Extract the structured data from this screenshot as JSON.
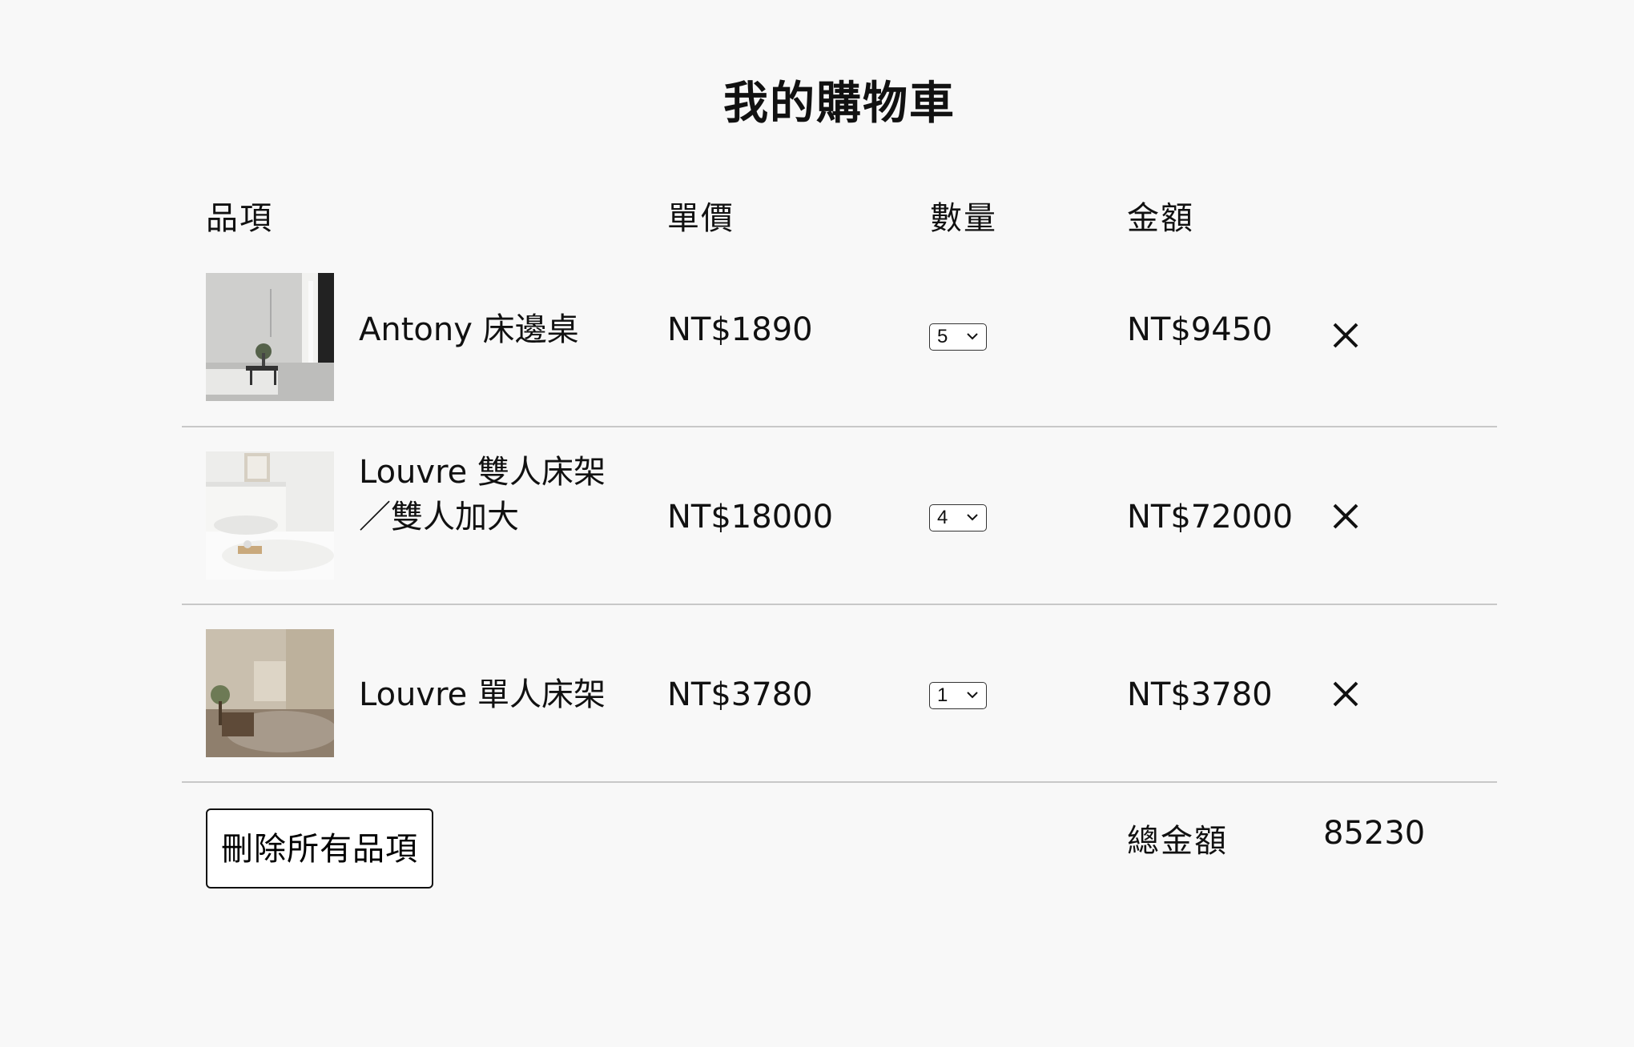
{
  "page": {
    "title": "我的購物車"
  },
  "table": {
    "headers": {
      "item": "品項",
      "unit_price": "單價",
      "quantity": "數量",
      "amount": "金額"
    },
    "items": [
      {
        "name": "Antony 床邊桌",
        "price": "NT$1890",
        "quantity": "5",
        "subtotal": "NT$9450",
        "image": "bedside-table-photo"
      },
      {
        "name": "Louvre 雙人床架／雙人加大",
        "price": "NT$18000",
        "quantity": "4",
        "subtotal": "NT$72000",
        "image": "double-bed-photo"
      },
      {
        "name": "Louvre 單人床架",
        "price": "NT$3780",
        "quantity": "1",
        "subtotal": "NT$3780",
        "image": "single-bed-photo"
      }
    ]
  },
  "footer": {
    "clear_all_label": "刪除所有品項",
    "total_label": "總金額",
    "total_value": "85230"
  },
  "icons": {
    "remove": "close-icon",
    "dropdown": "chevron-down-icon"
  },
  "colors": {
    "background": "#f8f8f8",
    "divider": "#c8c8c8",
    "text": "#111111"
  }
}
